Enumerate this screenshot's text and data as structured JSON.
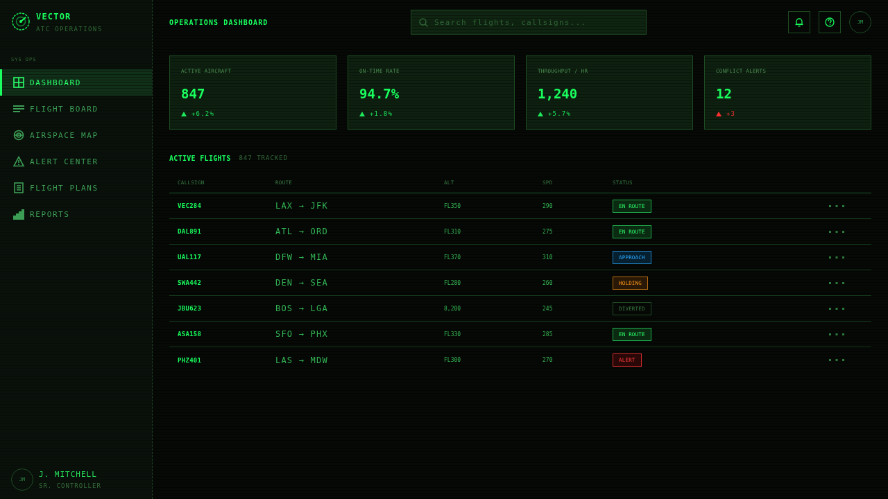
{
  "sidebar": {
    "brand": {
      "name": "VECTOR",
      "subtitle": "ATC OPERATIONS"
    },
    "section_label": "SYS OPS",
    "items": [
      {
        "label": "DASHBOARD",
        "selected": true
      },
      {
        "label": "FLIGHT BOARD",
        "selected": false
      },
      {
        "label": "AIRSPACE MAP",
        "selected": false
      },
      {
        "label": "ALERT CENTER",
        "selected": false
      },
      {
        "label": "FLIGHT PLANS",
        "selected": false
      },
      {
        "label": "REPORTS",
        "selected": false
      }
    ],
    "user": {
      "initials": "JM",
      "name": "J. MITCHELL",
      "role": "SR. CONTROLLER"
    }
  },
  "header": {
    "title": "OPERATIONS DASHBOARD",
    "search": {
      "placeholder": "Search flights, callsigns..."
    },
    "avatar": "JM"
  },
  "kpis": [
    {
      "label": "ACTIVE AIRCRAFT",
      "value": "847",
      "delta": "+6.2%",
      "rising": true,
      "warning": false
    },
    {
      "label": "ON-TIME RATE",
      "value": "94.7%",
      "delta": "+1.8%",
      "rising": true,
      "warning": false
    },
    {
      "label": "THROUGHPUT / HR",
      "value": "1,240",
      "delta": "+5.7%",
      "rising": true,
      "warning": false
    },
    {
      "label": "CONFLICT ALERTS",
      "value": "12",
      "delta": "+3",
      "rising": true,
      "warning": true
    }
  ],
  "flights": {
    "title": "ACTIVE FLIGHTS",
    "count": "847 TRACKED",
    "columns": [
      "CALLSIGN",
      "ROUTE",
      "ALT",
      "SPD",
      "STATUS"
    ],
    "rows": [
      {
        "callsign": "VEC284",
        "route": "LAX → JFK",
        "alt": "FL350",
        "spd": "290",
        "status": {
          "label": "EN ROUTE",
          "kind": "en_route"
        }
      },
      {
        "callsign": "DAL891",
        "route": "ATL → ORD",
        "alt": "FL310",
        "spd": "275",
        "status": {
          "label": "EN ROUTE",
          "kind": "en_route"
        }
      },
      {
        "callsign": "UAL117",
        "route": "DFW → MIA",
        "alt": "FL370",
        "spd": "310",
        "status": {
          "label": "APPROACH",
          "kind": "approach"
        }
      },
      {
        "callsign": "SWA442",
        "route": "DEN → SEA",
        "alt": "FL280",
        "spd": "260",
        "status": {
          "label": "HOLDING",
          "kind": "holding"
        }
      },
      {
        "callsign": "JBU623",
        "route": "BOS → LGA",
        "alt": "8,200",
        "spd": "245",
        "status": {
          "label": "DIVERTED",
          "kind": "diverted"
        }
      },
      {
        "callsign": "ASA158",
        "route": "SFO → PHX",
        "alt": "FL330",
        "spd": "285",
        "status": {
          "label": "EN ROUTE",
          "kind": "en_route"
        }
      },
      {
        "callsign": "PHZ401",
        "route": "LAS → MDW",
        "alt": "FL300",
        "spd": "270",
        "status": {
          "label": "ALERT",
          "kind": "alert"
        }
      }
    ]
  }
}
